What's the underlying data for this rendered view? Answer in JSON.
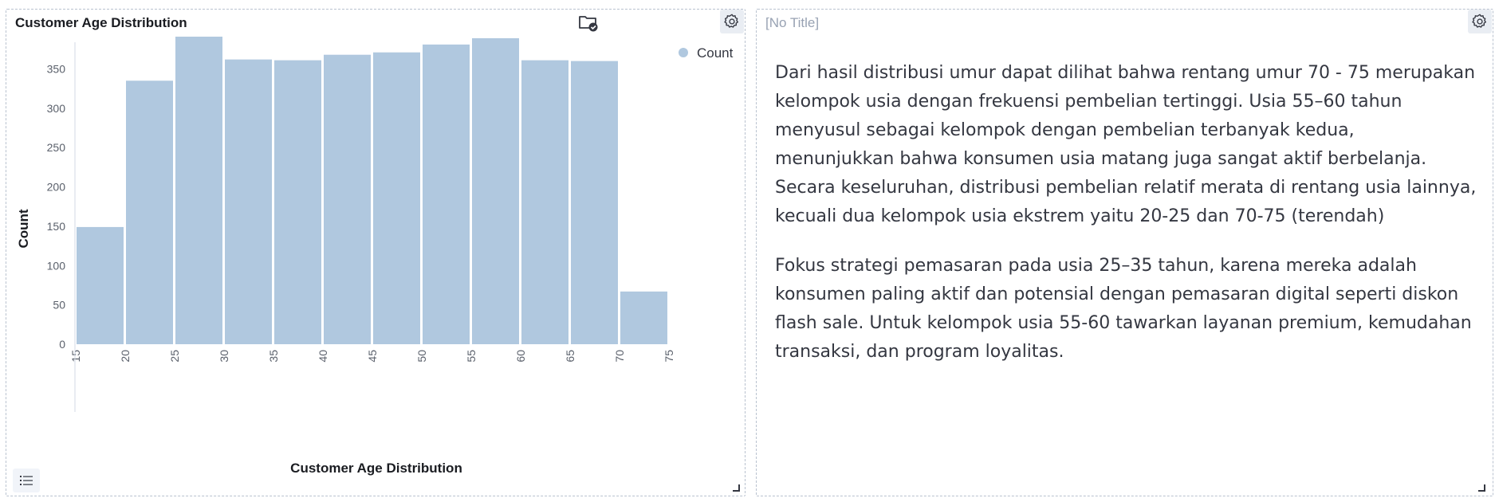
{
  "left_panel": {
    "title": "Customer Age Distribution",
    "icons": [
      "folder-check-icon",
      "gear-icon",
      "legend-list-icon",
      "resize-icon"
    ]
  },
  "right_panel": {
    "title": "[No Title]",
    "paragraphs": [
      "Dari hasil distribusi umur dapat dilihat bahwa rentang umur 70 - 75 merupakan kelompok usia dengan frekuensi pembelian tertinggi. Usia 55–60 tahun menyusul sebagai kelompok dengan pembelian terbanyak kedua, menunjukkan bahwa konsumen usia matang juga sangat aktif berbelanja. Secara keseluruhan, distribusi pembelian relatif merata di rentang usia lainnya, kecuali dua kelompok usia ekstrem yaitu 20-25 dan 70-75 (terendah)",
      "Fokus strategi pemasaran pada usia 25–35 tahun, karena mereka adalah konsumen paling aktif dan potensial dengan pemasaran digital seperti diskon flash sale. Untuk kelompok usia 55-60 tawarkan layanan premium, kemudahan transaksi, dan program loyalitas."
    ],
    "icons": [
      "gear-icon",
      "resize-icon"
    ]
  },
  "chart_data": {
    "type": "bar",
    "title": "Customer Age Distribution",
    "xlabel": "Customer Age Distribution",
    "ylabel": "Count",
    "bin_edges": [
      15,
      20,
      25,
      30,
      35,
      40,
      45,
      50,
      55,
      60,
      65,
      70,
      75
    ],
    "x_ticks": [
      "15",
      "20",
      "25",
      "30",
      "35",
      "40",
      "45",
      "50",
      "55",
      "60",
      "65",
      "70",
      "75"
    ],
    "values": [
      149,
      335,
      391,
      362,
      361,
      368,
      371,
      381,
      389,
      361,
      360,
      67
    ],
    "y_ticks": [
      0,
      50,
      100,
      150,
      200,
      250,
      300,
      350
    ],
    "ylim": [
      0,
      391
    ],
    "series": [
      {
        "name": "Count",
        "values": [
          149,
          335,
          391,
          362,
          361,
          368,
          371,
          381,
          389,
          361,
          360,
          67
        ]
      }
    ],
    "legend_position": "top-right",
    "grid": false,
    "colors": {
      "bar": "#b0c8df",
      "axis_text": "#5a606b",
      "legend_dot": "#b0c8df"
    }
  }
}
